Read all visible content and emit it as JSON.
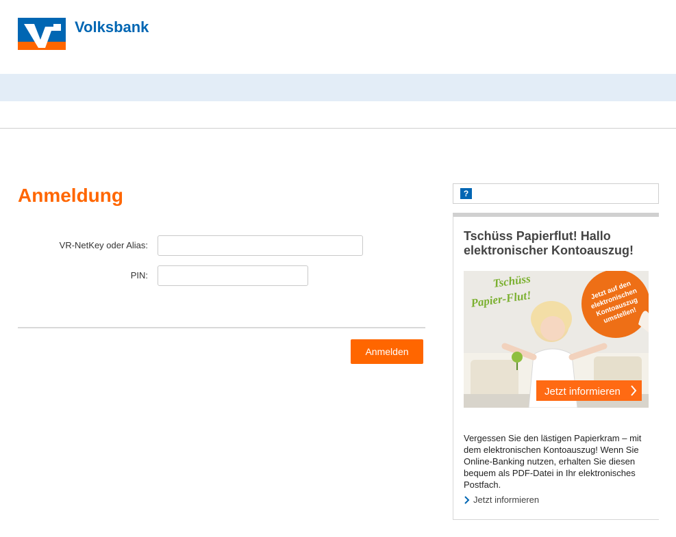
{
  "header": {
    "brand": "Volksbank",
    "logo_icon": "volksbank-logo-icon",
    "colors": {
      "brand_blue": "#0066b3",
      "brand_orange": "#ff6600",
      "nav_band": "#e3edf7"
    }
  },
  "login": {
    "title": "Anmeldung",
    "user_label": "VR-NetKey oder Alias:",
    "user_value": "",
    "pin_label": "PIN:",
    "pin_value": "",
    "submit_label": "Anmelden"
  },
  "sidebar": {
    "help_icon": "help-icon",
    "help_glyph": "?",
    "promo": {
      "title": "Tschüss Papierflut! Hallo elektronischer Kontoauszug!",
      "image": {
        "headline_line1": "Tschüss",
        "headline_line2": "Papier-Flut!",
        "sticker_line1": "Jetzt auf den",
        "sticker_line2": "elektronischen",
        "sticker_line3": "Kontoauszug",
        "sticker_line4": "umstellen!",
        "cta": "Jetzt informieren"
      },
      "text": "Vergessen Sie den lästigen Papierkram – mit dem elektronischen Kontoauszug! Wenn Sie Online-Banking nutzen, erhalten Sie diesen bequem als PDF-Datei in Ihr elektronisches Postfach.",
      "link": "Jetzt informieren"
    }
  }
}
